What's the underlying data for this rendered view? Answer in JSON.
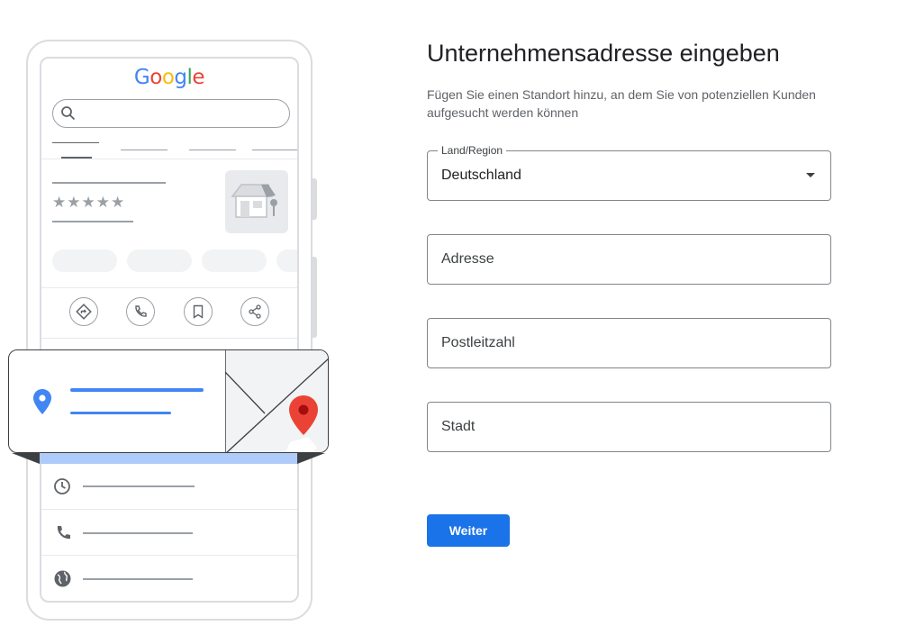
{
  "illustration": {
    "logo": [
      "G",
      "o",
      "o",
      "g",
      "l",
      "e"
    ],
    "logo_colors": [
      "#4285f4",
      "#ea4335",
      "#fbbc05",
      "#4285f4",
      "#34a853",
      "#ea4335"
    ],
    "stars": "★★★★★",
    "icons": [
      "search-icon",
      "directions-icon",
      "phone-icon",
      "bookmark-icon",
      "share-icon",
      "pin-icon",
      "clock-icon",
      "globe-icon"
    ]
  },
  "form": {
    "title": "Unternehmensadresse eingeben",
    "subtitle": "Fügen Sie einen Standort hinzu, an dem Sie von potenziellen Kunden aufgesucht werden können",
    "country": {
      "label": "Land/Region",
      "value": "Deutschland"
    },
    "address": {
      "placeholder": "Adresse"
    },
    "postal": {
      "placeholder": "Postleitzahl"
    },
    "city": {
      "placeholder": "Stadt"
    },
    "submit_label": "Weiter"
  },
  "colors": {
    "accent": "#1a73e8",
    "map_pin_red": "#ea4335",
    "pin_blue": "#4285f4"
  }
}
